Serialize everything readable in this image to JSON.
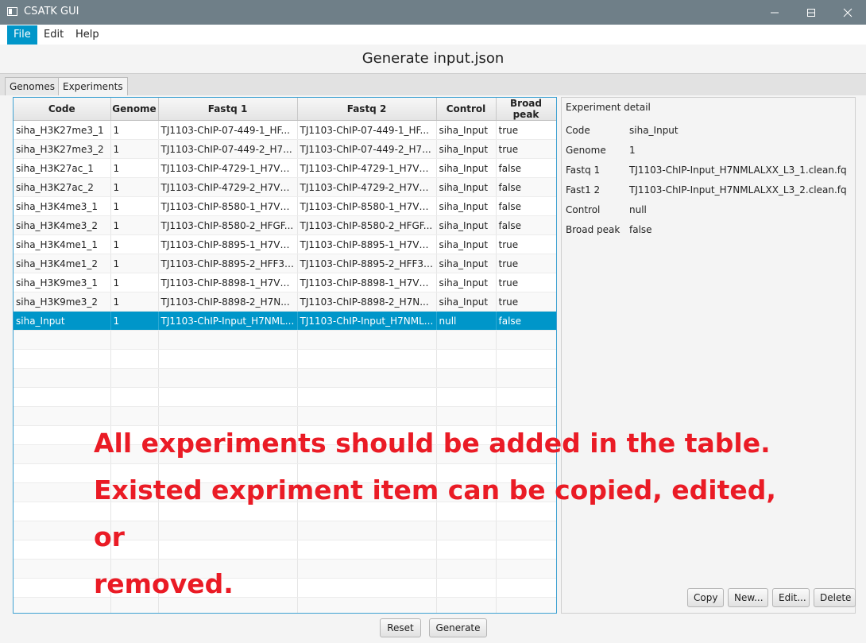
{
  "window": {
    "title": "CSATK GUI"
  },
  "menu": [
    "File",
    "Edit",
    "Help"
  ],
  "header": {
    "title": "Generate input.json"
  },
  "tabs": [
    "Genomes",
    "Experiments"
  ],
  "table": {
    "columns": [
      "Code",
      "Genome",
      "Fastq 1",
      "Fastq 2",
      "Control",
      "Broad peak"
    ],
    "rows": [
      [
        "siha_H3K27me3_1",
        "1",
        "TJ1103-ChIP-07-449-1_HF...",
        "TJ1103-ChIP-07-449-1_HF...",
        "siha_Input",
        "true"
      ],
      [
        "siha_H3K27me3_2",
        "1",
        "TJ1103-ChIP-07-449-2_H7...",
        "TJ1103-ChIP-07-449-2_H7...",
        "siha_Input",
        "true"
      ],
      [
        "siha_H3K27ac_1",
        "1",
        "TJ1103-ChIP-4729-1_H7VH...",
        "TJ1103-ChIP-4729-1_H7VH...",
        "siha_Input",
        "false"
      ],
      [
        "siha_H3K27ac_2",
        "1",
        "TJ1103-ChIP-4729-2_H7VH...",
        "TJ1103-ChIP-4729-2_H7VH...",
        "siha_Input",
        "false"
      ],
      [
        "siha_H3K4me3_1",
        "1",
        "TJ1103-ChIP-8580-1_H7VH...",
        "TJ1103-ChIP-8580-1_H7VH...",
        "siha_Input",
        "false"
      ],
      [
        "siha_H3K4me3_2",
        "1",
        "TJ1103-ChIP-8580-2_HFGF...",
        "TJ1103-ChIP-8580-2_HFGF...",
        "siha_Input",
        "false"
      ],
      [
        "siha_H3K4me1_1",
        "1",
        "TJ1103-ChIP-8895-1_H7VH...",
        "TJ1103-ChIP-8895-1_H7VH...",
        "siha_Input",
        "true"
      ],
      [
        "siha_H3K4me1_2",
        "1",
        "TJ1103-ChIP-8895-2_HFF3T...",
        "TJ1103-ChIP-8895-2_HFF3T...",
        "siha_Input",
        "true"
      ],
      [
        "siha_H3K9me3_1",
        "1",
        "TJ1103-ChIP-8898-1_H7VH...",
        "TJ1103-ChIP-8898-1_H7VH...",
        "siha_Input",
        "true"
      ],
      [
        "siha_H3K9me3_2",
        "1",
        "TJ1103-ChIP-8898-2_H7N...",
        "TJ1103-ChIP-8898-2_H7N...",
        "siha_Input",
        "true"
      ],
      [
        "siha_Input",
        "1",
        "TJ1103-ChIP-Input_H7NML...",
        "TJ1103-ChIP-Input_H7NML...",
        "null",
        "false"
      ]
    ],
    "selected_row": 10
  },
  "detail": {
    "title": "Experiment detail",
    "fields": [
      {
        "label": "Code",
        "value": "siha_Input"
      },
      {
        "label": "Genome",
        "value": "1"
      },
      {
        "label": "Fastq 1",
        "value": "TJ1103-ChIP-Input_H7NMLALXX_L3_1.clean.fq"
      },
      {
        "label": "Fast1 2",
        "value": "TJ1103-ChIP-Input_H7NMLALXX_L3_2.clean.fq"
      },
      {
        "label": "Control",
        "value": "null"
      },
      {
        "label": "Broad peak",
        "value": "false"
      }
    ],
    "buttons": [
      "Copy",
      "New...",
      "Edit...",
      "Delete"
    ]
  },
  "footer": {
    "reset": "Reset",
    "generate": "Generate"
  },
  "annotation": {
    "line1": "All experiments should be added in the table.",
    "line2": "Existed expriment item can be copied, edited, or",
    "line3": "removed.",
    "color": "#ea1b25"
  },
  "colors": {
    "accent": "#0096c9",
    "titlebar": "#6f7f88"
  }
}
